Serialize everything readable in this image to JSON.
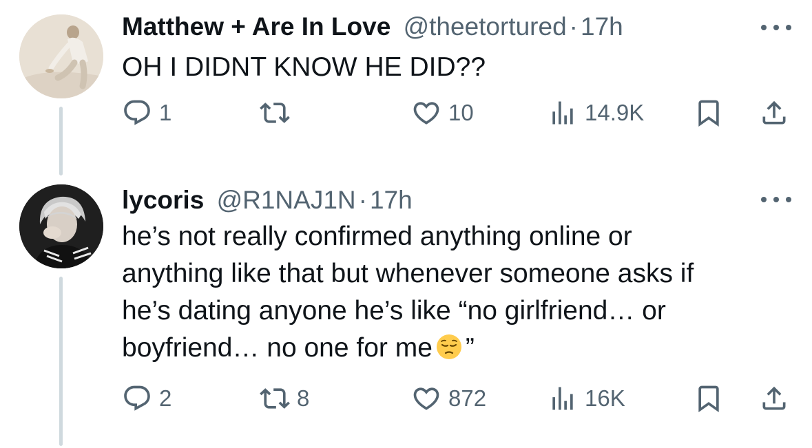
{
  "tweets": [
    {
      "display_name": "Matthew + Are In Love",
      "handle": "@theetortured",
      "separator": "·",
      "time": "17h",
      "text_lines": [
        "OH I DIDNT KNOW HE DID??"
      ],
      "counts": {
        "replies": "1",
        "retweets": "",
        "likes": "10",
        "views": "14.9K"
      }
    },
    {
      "display_name": "lycoris",
      "handle": "@R1NAJ1N",
      "separator": "·",
      "time": "17h",
      "text_lines": [
        "he’s not really confirmed anything online or",
        "anything like that but whenever someone asks if",
        "he’s dating anyone he’s like “no girlfriend… or",
        "boyfriend… no one for me"
      ],
      "text_tail": "”",
      "emoji": "pensive-face",
      "counts": {
        "replies": "2",
        "retweets": "8",
        "likes": "872",
        "views": "16K"
      }
    }
  ],
  "icons": {
    "reply": "reply-icon",
    "retweet": "retweet-icon",
    "like": "heart-icon",
    "views": "analytics-icon",
    "bookmark": "bookmark-icon",
    "share": "share-icon",
    "more": "more-icon"
  },
  "colors": {
    "text_primary": "#0f1419",
    "text_secondary": "#536471",
    "thread_line": "#cfd9de",
    "background": "#ffffff"
  }
}
